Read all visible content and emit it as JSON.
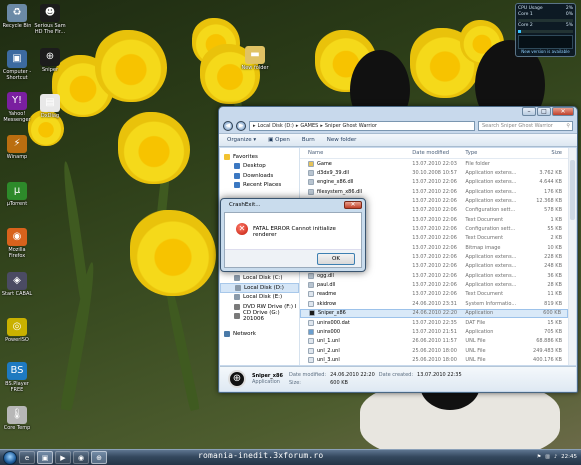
{
  "desktop": {
    "icons": [
      {
        "label": "Recycle Bin",
        "glyph": "♻",
        "color": "#6b8aa6"
      },
      {
        "label": "Computer - Shortcut",
        "glyph": "▣",
        "color": "#3c6aa0"
      },
      {
        "label": "Yahoo! Messenger",
        "glyph": "Y!",
        "color": "#7a1fa0"
      },
      {
        "label": "Winamp",
        "glyph": "⚡",
        "color": "#ba6e10"
      },
      {
        "label": "µTorrent",
        "glyph": "µ",
        "color": "#2d8a2a"
      },
      {
        "label": "Mozilla Firefox",
        "glyph": "◉",
        "color": "#d8621c"
      },
      {
        "label": "Start CABAL",
        "glyph": "◈",
        "color": "#4b4b63"
      },
      {
        "label": "PowerISO",
        "glyph": "◎",
        "color": "#c9b100"
      },
      {
        "label": "BS.Player FREE",
        "glyph": "BS",
        "color": "#1e7ac0"
      },
      {
        "label": "Core Temp",
        "glyph": "🌡",
        "color": "#b7b7b7"
      },
      {
        "label": "Serious Sam HD The Fir...",
        "glyph": "☻",
        "color": "#1c1c1c"
      },
      {
        "label": "Sniper",
        "glyph": "⊕",
        "color": "#1c1c1c"
      },
      {
        "label": "DxDiag",
        "glyph": "▤",
        "color": "#e8e8e8"
      },
      {
        "label": "New folder",
        "glyph": "▬",
        "color": "#e0c264"
      }
    ]
  },
  "cpu_gadget": {
    "title": "CPU Usage",
    "total": "2%",
    "cores": [
      {
        "name": "Core 1",
        "value": "0%",
        "level": 0.0
      },
      {
        "name": "Core 2",
        "value": "5%",
        "level": 0.05
      }
    ],
    "footer": "New version is available"
  },
  "explorer": {
    "breadcrumb": [
      "Local Disk (D:)",
      "GAMES",
      "Sniper Ghost Warrior"
    ],
    "search_placeholder": "Search Sniper Ghost Warrior",
    "toolbar": {
      "organize": "Organize ▾",
      "open": "Open",
      "burn": "Burn",
      "new_folder": "New folder"
    },
    "nav": [
      {
        "label": "Favorites",
        "sub": false,
        "color": "#f2c230"
      },
      {
        "label": "Desktop",
        "sub": true,
        "color": "#3b78c2"
      },
      {
        "label": "Downloads",
        "sub": true,
        "color": "#3b78c2"
      },
      {
        "label": "Recent Places",
        "sub": true,
        "color": "#3b78c2"
      },
      {
        "label": "Computer",
        "sub": false,
        "color": "#5a7a9a"
      },
      {
        "label": "Local Disk (C:)",
        "sub": true,
        "color": "#8a9aaa"
      },
      {
        "label": "Local Disk (D:)",
        "sub": true,
        "color": "#8a9aaa",
        "selected": true
      },
      {
        "label": "Local Disk (E:)",
        "sub": true,
        "color": "#8a9aaa"
      },
      {
        "label": "DVD RW Drive (F:) I",
        "sub": true,
        "color": "#7a7a7a"
      },
      {
        "label": "CD Drive (G:) 201006",
        "sub": true,
        "color": "#7a7a7a"
      },
      {
        "label": "Network",
        "sub": false,
        "color": "#4a7aa8"
      }
    ],
    "columns": {
      "name": "Name",
      "date": "Date modified",
      "type": "Type",
      "size": "Size"
    },
    "files": [
      {
        "name": "Game",
        "date": "13.07.2010 22:03",
        "type": "File folder",
        "size": "",
        "color": "#e6c35a"
      },
      {
        "name": "d3dx9_39.dll",
        "date": "30.10.2008 10:57",
        "type": "Application extens...",
        "size": "3.762 KB",
        "color": "#b8c4d0"
      },
      {
        "name": "engine_x86.dll",
        "date": "13.07.2010 22:06",
        "type": "Application extens...",
        "size": "4.644 KB",
        "color": "#b8c4d0"
      },
      {
        "name": "filesystem_x86.dll",
        "date": "13.07.2010 22:06",
        "type": "Application extens...",
        "size": "176 KB",
        "color": "#b8c4d0"
      },
      {
        "name": "fmodex.dll",
        "date": "13.07.2010 22:06",
        "type": "Application extens...",
        "size": "12.368 KB",
        "color": "#b8c4d0"
      },
      {
        "name": "fmodevent.dll",
        "date": "13.07.2010 22:06",
        "type": "Configuration sett...",
        "size": "578 KB",
        "color": "#b8c4d0"
      },
      {
        "name": "language.txt",
        "date": "13.07.2010 22:06",
        "type": "Text Document",
        "size": "1 KB",
        "color": "#dfe6ee"
      },
      {
        "name": "launcher.cfg",
        "date": "13.07.2010 22:06",
        "type": "Configuration sett...",
        "size": "55 KB",
        "color": "#dfe6ee"
      },
      {
        "name": "launcher.log",
        "date": "13.07.2010 22:06",
        "type": "Text Document",
        "size": "2 KB",
        "color": "#dfe6ee"
      },
      {
        "name": "logo.bmp",
        "date": "13.07.2010 22:06",
        "type": "Bitmap image",
        "size": "10 KB",
        "color": "#dfe6ee"
      },
      {
        "name": "mss32.dll",
        "date": "13.07.2010 22:06",
        "type": "Application extens...",
        "size": "228 KB",
        "color": "#b8c4d0"
      },
      {
        "name": "npc_x86.dll",
        "date": "13.07.2010 22:06",
        "type": "Application extens...",
        "size": "248 KB",
        "color": "#b8c4d0"
      },
      {
        "name": "ogg.dll",
        "date": "13.07.2010 22:06",
        "type": "Application extens...",
        "size": "36 KB",
        "color": "#b8c4d0"
      },
      {
        "name": "paul.dll",
        "date": "13.07.2010 22:06",
        "type": "Application extens...",
        "size": "28 KB",
        "color": "#b8c4d0"
      },
      {
        "name": "readme",
        "date": "13.07.2010 22:06",
        "type": "Text Document",
        "size": "11 KB",
        "color": "#dfe6ee"
      },
      {
        "name": "skidrow",
        "date": "24.06.2010 23:31",
        "type": "System Informatio...",
        "size": "819 KB",
        "color": "#dfe6ee"
      },
      {
        "name": "Sniper_x86",
        "date": "24.06.2010 22:20",
        "type": "Application",
        "size": "600 KB",
        "color": "#1a1a1a",
        "selected": true
      },
      {
        "name": "unins000.dat",
        "date": "13.07.2010 22:35",
        "type": "DAT File",
        "size": "15 KB",
        "color": "#dfe6ee"
      },
      {
        "name": "unins000",
        "date": "13.07.2010 21:51",
        "type": "Application",
        "size": "705 KB",
        "color": "#6a9fd0"
      },
      {
        "name": "unl_1.unl",
        "date": "26.06.2010 11:57",
        "type": "UNL File",
        "size": "68.886 KB",
        "color": "#dfe6ee"
      },
      {
        "name": "unl_2.unl",
        "date": "25.06.2010 18:00",
        "type": "UNL File",
        "size": "249.483 KB",
        "color": "#dfe6ee"
      },
      {
        "name": "unl_3.unl",
        "date": "25.06.2010 18:00",
        "type": "UNL File",
        "size": "400.176 KB",
        "color": "#dfe6ee"
      }
    ],
    "details": {
      "name": "Sniper_x86",
      "kind": "Application",
      "date_modified_label": "Date modified:",
      "date_modified": "24.06.2010 22:20",
      "date_created_label": "Date created:",
      "date_created": "13.07.2010 22:35",
      "size_label": "Size:",
      "size": "600 KB"
    }
  },
  "dialog": {
    "title": "CrashExit...",
    "message": "FATAL ERROR Cannot initialize renderer",
    "ok_label": "OK"
  },
  "taskbar": {
    "watermark": "romania-inedit.3xforum.ro",
    "clock": "22:45",
    "pinned": [
      {
        "glyph": "e",
        "name": "ie-icon"
      },
      {
        "glyph": "▣",
        "name": "explorer-icon"
      },
      {
        "glyph": "▶",
        "name": "media-player-icon"
      },
      {
        "glyph": "◉",
        "name": "firefox-icon"
      },
      {
        "glyph": "⊕",
        "name": "sniper-icon"
      }
    ]
  }
}
